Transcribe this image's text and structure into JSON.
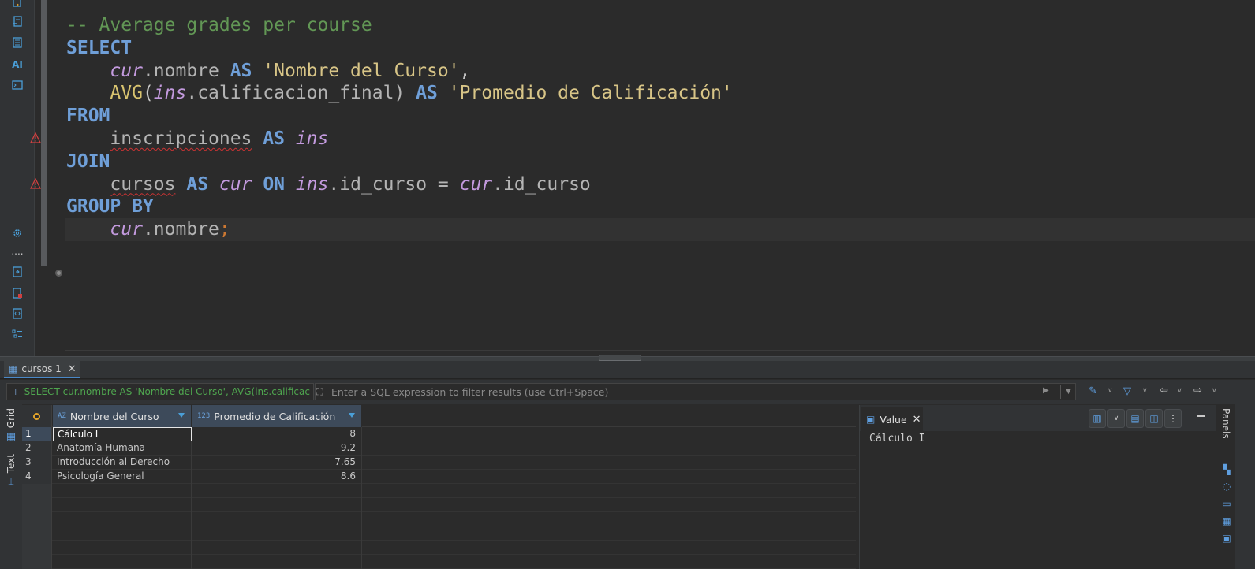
{
  "editor": {
    "lines": [
      [
        {
          "t": "cm",
          "v": "-- Average grades per course"
        }
      ],
      [
        {
          "t": "kw",
          "v": "SELECT"
        }
      ],
      [
        {
          "t": "op",
          "v": "    "
        },
        {
          "t": "al",
          "v": "cur"
        },
        {
          "t": "id",
          "v": ".nombre "
        },
        {
          "t": "kw",
          "v": "AS"
        },
        {
          "t": "op",
          "v": " "
        },
        {
          "t": "st",
          "v": "'Nombre del Curso'"
        },
        {
          "t": "op",
          "v": ","
        }
      ],
      [
        {
          "t": "op",
          "v": "    "
        },
        {
          "t": "fn",
          "v": "AVG"
        },
        {
          "t": "op",
          "v": "("
        },
        {
          "t": "al",
          "v": "ins"
        },
        {
          "t": "id",
          "v": ".calificacion_final) "
        },
        {
          "t": "kw",
          "v": "AS"
        },
        {
          "t": "op",
          "v": " "
        },
        {
          "t": "st",
          "v": "'Promedio de Calificación'"
        }
      ],
      [
        {
          "t": "kw",
          "v": "FROM"
        }
      ],
      [
        {
          "t": "op",
          "v": "    "
        },
        {
          "t": "id squig",
          "v": "inscripciones"
        },
        {
          "t": "op",
          "v": " "
        },
        {
          "t": "kw",
          "v": "AS"
        },
        {
          "t": "op",
          "v": " "
        },
        {
          "t": "al",
          "v": "ins"
        }
      ],
      [
        {
          "t": "kw",
          "v": "JOIN"
        }
      ],
      [
        {
          "t": "op",
          "v": "    "
        },
        {
          "t": "id squig",
          "v": "cursos"
        },
        {
          "t": "op",
          "v": " "
        },
        {
          "t": "kw",
          "v": "AS"
        },
        {
          "t": "op",
          "v": " "
        },
        {
          "t": "al",
          "v": "cur"
        },
        {
          "t": "op",
          "v": " "
        },
        {
          "t": "kw",
          "v": "ON"
        },
        {
          "t": "op",
          "v": " "
        },
        {
          "t": "al",
          "v": "ins"
        },
        {
          "t": "id",
          "v": ".id_curso = "
        },
        {
          "t": "al",
          "v": "cur"
        },
        {
          "t": "id",
          "v": ".id_curso"
        }
      ],
      [
        {
          "t": "kw",
          "v": "GROUP BY"
        }
      ],
      [
        {
          "t": "op",
          "v": "    "
        },
        {
          "t": "al",
          "v": "cur"
        },
        {
          "t": "id",
          "v": ".nombre"
        },
        {
          "t": "semi",
          "v": ";"
        }
      ]
    ]
  },
  "gutter": {
    "ai_label": "AI",
    "dots_label": "....",
    "icons": [
      "run-script-icon",
      "explain-plan-icon",
      "sql-script-icon",
      "ai-assistant-icon",
      "terminal-icon",
      "settings-icon",
      "more-dots-icon",
      "export-icon",
      "error-log-icon",
      "sql-template-icon",
      "outline-icon"
    ]
  },
  "results": {
    "tab_label": "cursos 1",
    "query_preview": "SELECT cur.nombre AS 'Nombre del Curso', AVG(ins.calificac",
    "filter_placeholder": "Enter a SQL expression to filter results (use Ctrl+Space)",
    "side_tabs": {
      "grid": "Grid",
      "text": "Text"
    },
    "columns": [
      {
        "type": "AZ",
        "name": "Nombre del Curso"
      },
      {
        "type": "123",
        "name": "Promedio de Calificación"
      }
    ],
    "rows": [
      {
        "n": "1",
        "nombre": "Cálculo I",
        "promedio": "8"
      },
      {
        "n": "2",
        "nombre": "Anatomía Humana",
        "promedio": "9.2"
      },
      {
        "n": "3",
        "nombre": "Introducción al Derecho",
        "promedio": "7.65"
      },
      {
        "n": "4",
        "nombre": "Psicología General",
        "promedio": "8.6"
      }
    ]
  },
  "value_panel": {
    "title": "Value",
    "content": "Cálculo I"
  },
  "panels": {
    "label": "Panels"
  },
  "colors": {
    "keyword": "#6f9fd8",
    "comment": "#629755",
    "alias": "#c39ade",
    "string": "#d8c587",
    "accent": "#4a9fd8"
  }
}
